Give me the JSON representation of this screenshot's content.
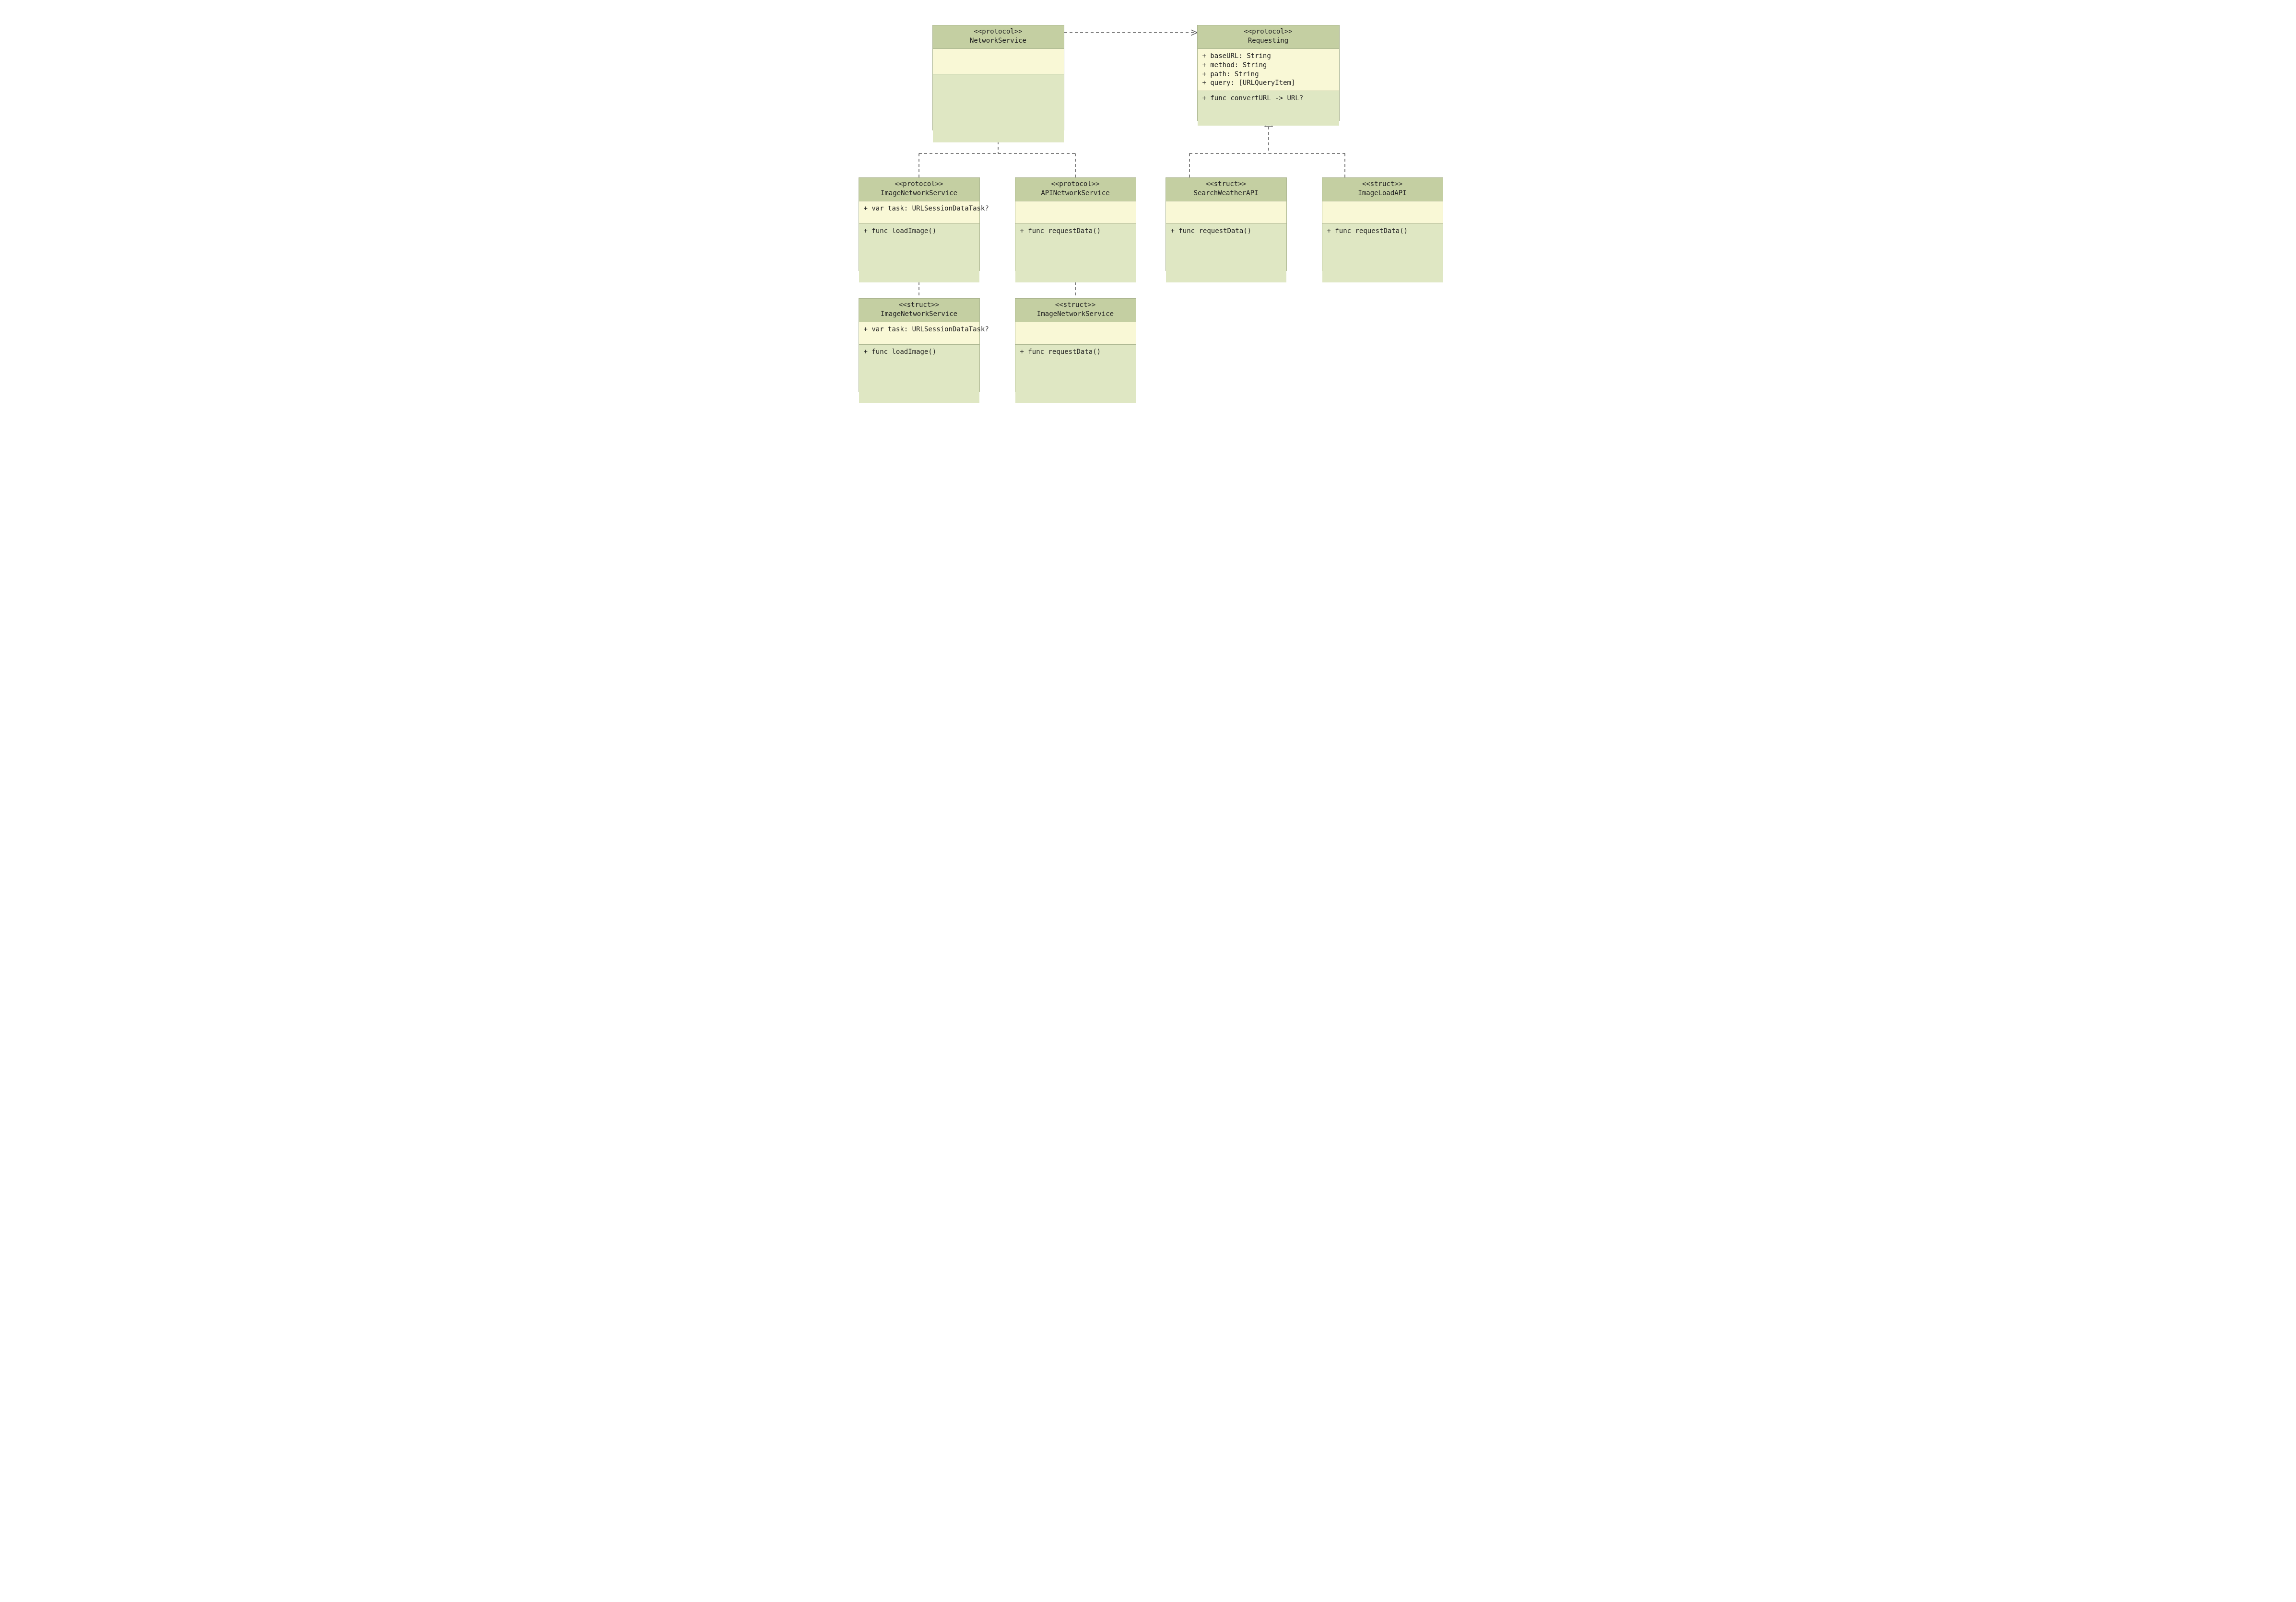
{
  "boxes": {
    "networkService": {
      "stereo": "<<protocol>>",
      "name": "NetworkService",
      "attrs": [],
      "ops": []
    },
    "requesting": {
      "stereo": "<<protocol>>",
      "name": "Requesting",
      "attrs": [
        "+ baseURL: String",
        "+ method: String",
        "+ path: String",
        "+ query: [URLQueryItem]"
      ],
      "ops": [
        "+ func convertURL -> URL?"
      ]
    },
    "imageNetworkServiceProtocol": {
      "stereo": "<<protocol>>",
      "name": "ImageNetworkService",
      "attrs": [
        "+ var task: URLSessionDataTask?"
      ],
      "ops": [
        "+ func loadImage()"
      ]
    },
    "apiNetworkServiceProtocol": {
      "stereo": "<<protocol>>",
      "name": "APINetworkService",
      "attrs": [],
      "ops": [
        "+ func requestData()"
      ]
    },
    "searchWeatherAPI": {
      "stereo": "<<struct>>",
      "name": "SearchWeatherAPI",
      "attrs": [],
      "ops": [
        "+ func requestData()"
      ]
    },
    "imageLoadAPI": {
      "stereo": "<<struct>>",
      "name": "ImageLoadAPI",
      "attrs": [],
      "ops": [
        "+ func requestData()"
      ]
    },
    "imageNetworkServiceStruct": {
      "stereo": "<<struct>>",
      "name": "ImageNetworkService",
      "attrs": [
        "+ var task: URLSessionDataTask?"
      ],
      "ops": [
        "+ func loadImage()"
      ]
    },
    "apiImageNetworkServiceStruct": {
      "stereo": "<<struct>>",
      "name": "ImageNetworkService",
      "attrs": [],
      "ops": [
        "+ func requestData()"
      ]
    }
  }
}
